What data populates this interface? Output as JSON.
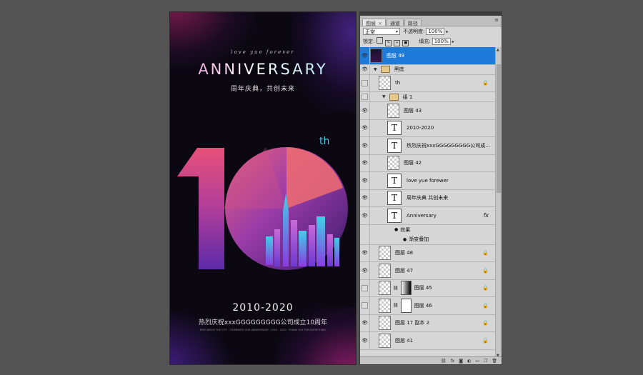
{
  "poster": {
    "script_text": "love yue forever",
    "title": "ANNIVERSARY",
    "subtitle": "周年庆典，共创未来",
    "superscript": "th",
    "years": "2010-2020",
    "slogan": "热烈庆祝xxxGGGGGGGGG公司成立10周年",
    "fine_print": "RISE ABOVE THE CITY · CELEBRATE OUR ANNIVERSARY · 2010 - 2020 · THANK YOU FOR EVERYTHING"
  },
  "panel": {
    "tabs": [
      {
        "label": "图层",
        "close": "×"
      },
      {
        "label": "通道"
      },
      {
        "label": "路径"
      }
    ],
    "menu_icon": "panel-menu-icon",
    "blend_mode": "正常",
    "opacity_label": "不透明度:",
    "opacity_value": "100%",
    "lock_label": "锁定:",
    "fill_label": "填充:",
    "fill_value": "100%",
    "layers": [
      {
        "name": "图层 49",
        "kind": "pixel",
        "visible": true,
        "selected": true
      },
      {
        "name": "黑底",
        "kind": "group",
        "visible": true
      },
      {
        "name": "th",
        "kind": "pixel",
        "visible": false,
        "locked": true
      },
      {
        "name": "组 1",
        "kind": "group",
        "visible": false
      },
      {
        "name": "图层 43",
        "kind": "pixel",
        "visible": true
      },
      {
        "name": "2010-2020",
        "kind": "text",
        "visible": true
      },
      {
        "name": "热烈庆祝xxxGGGGGGGGG公司成...",
        "kind": "text",
        "visible": true
      },
      {
        "name": "图层 42",
        "kind": "pixel",
        "visible": true
      },
      {
        "name": "love yue forewer",
        "kind": "text",
        "visible": true
      },
      {
        "name": "周年庆典 共创未来",
        "kind": "text",
        "visible": true
      },
      {
        "name": "Anniversary",
        "kind": "text",
        "visible": true,
        "fx": "fx"
      },
      {
        "name": "效果",
        "kind": "effect",
        "visible": true
      },
      {
        "name": "渐变叠加",
        "kind": "effect",
        "visible": true
      },
      {
        "name": "图层 48",
        "kind": "pixel",
        "visible": true,
        "locked": true
      },
      {
        "name": "图层 47",
        "kind": "pixel",
        "visible": true,
        "locked": true
      },
      {
        "name": "图层 45",
        "kind": "masked",
        "visible": false,
        "locked": true
      },
      {
        "name": "图层 46",
        "kind": "masked",
        "visible": false,
        "locked": true
      },
      {
        "name": "图层 17 副本 2",
        "kind": "pixel",
        "visible": true,
        "locked": true
      },
      {
        "name": "图层 41",
        "kind": "pixel",
        "visible": true,
        "locked": true
      }
    ],
    "footer_icons": [
      "link-icon",
      "fx-icon",
      "mask-icon",
      "adjustment-icon",
      "folder-icon",
      "new-layer-icon",
      "trash-icon"
    ]
  },
  "colors": {
    "selection": "#1e7ad8",
    "accent_cyan": "#3fd0e8",
    "accent_pink": "#e8507a",
    "accent_purple": "#8a3ce0"
  }
}
